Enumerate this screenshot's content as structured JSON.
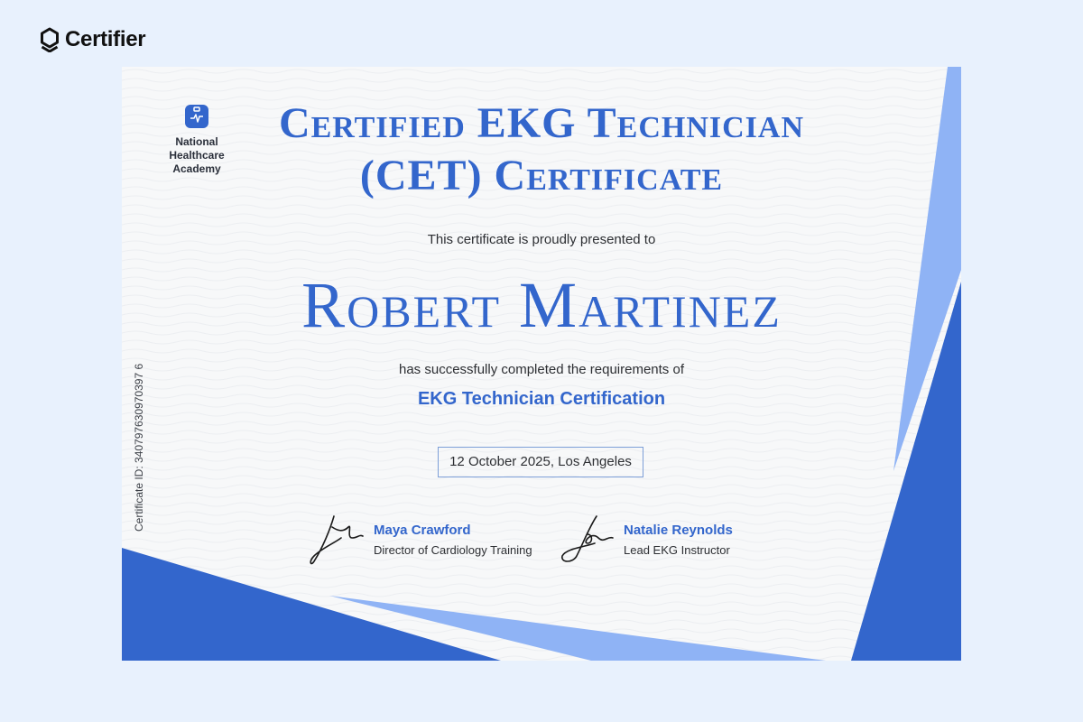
{
  "brand": {
    "name": "Certifier"
  },
  "organization": {
    "name_lines": [
      "National",
      "Healthcare",
      "Academy"
    ]
  },
  "certificate": {
    "title_line1": "Certified EKG Technician",
    "title_line2": "(CET) Certificate",
    "presented_text": "This certificate is proudly presented to",
    "recipient": "Robert Martinez",
    "completed_text": "has successfully completed the requirements of",
    "course": "EKG Technician Certification",
    "date_location": "12 October 2025, Los Angeles",
    "certificate_id": "Certificate ID: 340797630970397 6"
  },
  "signatures": [
    {
      "name": "Maya Crawford",
      "role": "Director of Cardiology Training"
    },
    {
      "name": "Natalie Reynolds",
      "role": "Lead EKG Instructor"
    }
  ],
  "colors": {
    "accent": "#3366cc",
    "accent_light": "#8fb3f5",
    "page_bg": "#e8f1fd",
    "certificate_bg": "#f7f8f9"
  },
  "icons": {
    "brand": "certifier-logo-icon",
    "organization": "medical-kit-heartbeat-icon"
  }
}
